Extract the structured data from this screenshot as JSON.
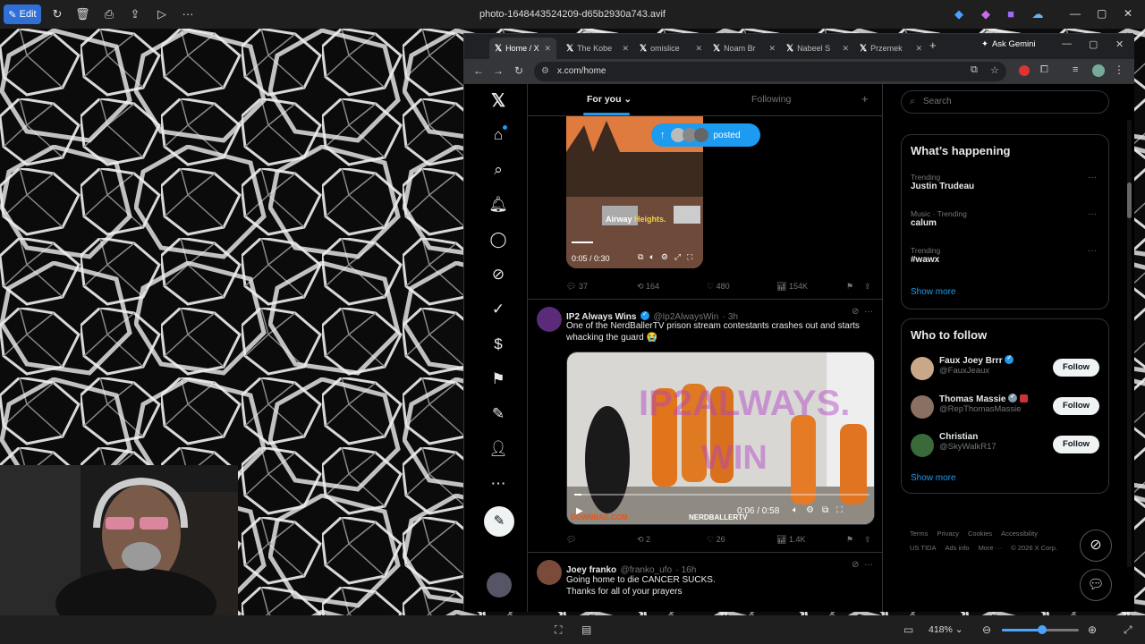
{
  "app": {
    "edit_label": "Edit",
    "file_title": "photo-1648443524209-d65b2930a743.avif",
    "zoom": "418%"
  },
  "browser": {
    "tabs": [
      {
        "label": "Home / X"
      },
      {
        "label": "The Kobe"
      },
      {
        "label": "omislice"
      },
      {
        "label": "Noam Br"
      },
      {
        "label": "Nabeel S"
      },
      {
        "label": "Przemek"
      }
    ],
    "ask_gemini": "Ask Gemini",
    "url": "x.com/home"
  },
  "twitter": {
    "tabs": {
      "for_you": "For you",
      "following": "Following"
    },
    "posted_pill": "posted",
    "search_placeholder": "Search",
    "tweet1": {
      "video_caption_a": "Airway",
      "video_caption_b": "Heights.",
      "video_time": "0:05 / 0:30",
      "replies": "37",
      "reposts": "164",
      "likes": "480",
      "views": "154K"
    },
    "tweet2": {
      "name": "IP2 Always Wins",
      "handle": "@Ip2AlwaysWin",
      "time": "· 3h",
      "text": "One of the NerdBallerTV prison stream contestants crashes out and starts whacking the guard 😭",
      "video_time": "0:06 / 0:58",
      "watermark1": "DOWNBAD.COM",
      "watermark2": "NERDBALLERTV",
      "replies": "",
      "reposts": "2",
      "likes": "26",
      "views": "1.4K"
    },
    "tweet3": {
      "name": "Joey franko",
      "handle": "@franko_ufo",
      "time": "· 16h",
      "text_line1": "Going home to die CANCER SUCKS.",
      "text_line2": "Thanks for all of your prayers"
    },
    "whats_happening": {
      "title": "What’s happening",
      "trends": [
        {
          "meta": "Trending",
          "name": "Justin Trudeau"
        },
        {
          "meta": "Music · Trending",
          "name": "calum"
        },
        {
          "meta": "Trending",
          "name": "#wawx"
        }
      ],
      "show_more": "Show more"
    },
    "who_to_follow": {
      "title": "Who to follow",
      "people": [
        {
          "name": "Faux Joey Brrr",
          "handle": "@FauxJeaux",
          "button": "Follow"
        },
        {
          "name": "Thomas Massie",
          "handle": "@RepThomasMassie",
          "button": "Follow"
        },
        {
          "name": "Christian",
          "handle": "@SkyWalkR17",
          "button": "Follow"
        }
      ],
      "show_more": "Show more"
    },
    "footer": {
      "line1": [
        "Terms",
        "Privacy",
        "Cookies",
        "Accessibility"
      ],
      "line2": [
        "US TIDA",
        "Ads info",
        "More ···",
        "© 2026 X Corp."
      ]
    }
  },
  "colors": {
    "accent": "#1d9bf0",
    "edit_button": "#2f6fd6"
  }
}
